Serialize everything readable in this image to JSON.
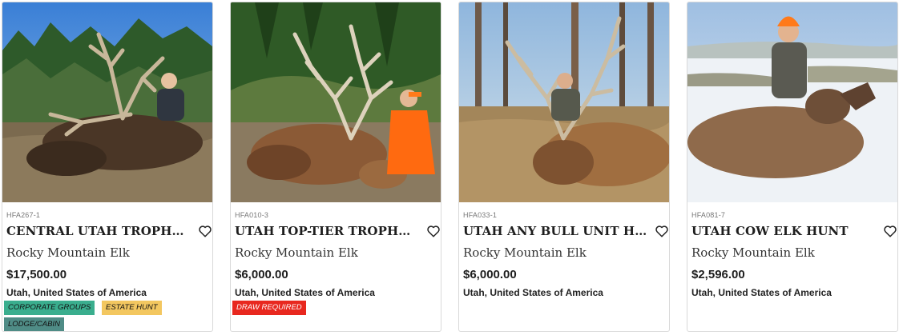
{
  "listings": [
    {
      "sku": "HFA267-1",
      "title": "CENTRAL UTAH TROPHY ELK HUNT",
      "species": "Rocky Mountain Elk",
      "price": "$17,500.00",
      "location": "Utah, United States of America",
      "favorite_icon": "heart-outline-icon",
      "photo_description": "hunter-with-trophy-bull-elk",
      "tags": [
        {
          "label": "CORPORATE GROUPS",
          "color": "#3aae8e"
        },
        {
          "label": "ESTATE HUNT",
          "color": "#f3c760"
        },
        {
          "label": "LODGE/CABIN",
          "color": "#4f8c86"
        }
      ]
    },
    {
      "sku": "HFA010-3",
      "title": "UTAH TOP-TIER TROPHY ELK HUNT",
      "species": "Rocky Mountain Elk",
      "price": "$6,000.00",
      "location": "Utah, United States of America",
      "favorite_icon": "heart-outline-icon",
      "photo_description": "hunter-in-orange-with-trophy-bull-elk",
      "tags": [
        {
          "label": "DRAW REQUIRED",
          "color": "#e8281f"
        }
      ]
    },
    {
      "sku": "HFA033-1",
      "title": "UTAH ANY BULL UNIT HORSEBACK ELK HUNT",
      "species": "Rocky Mountain Elk",
      "price": "$6,000.00",
      "location": "Utah, United States of America",
      "favorite_icon": "heart-outline-icon",
      "photo_description": "hunter-in-forest-with-bull-elk",
      "tags": []
    },
    {
      "sku": "HFA081-7",
      "title": "UTAH COW ELK HUNT",
      "species": "Rocky Mountain Elk",
      "price": "$2,596.00",
      "location": "Utah, United States of America",
      "favorite_icon": "heart-outline-icon",
      "photo_description": "hunter-in-orange-beanie-with-cow-elk-in-snow",
      "tags": []
    }
  ]
}
